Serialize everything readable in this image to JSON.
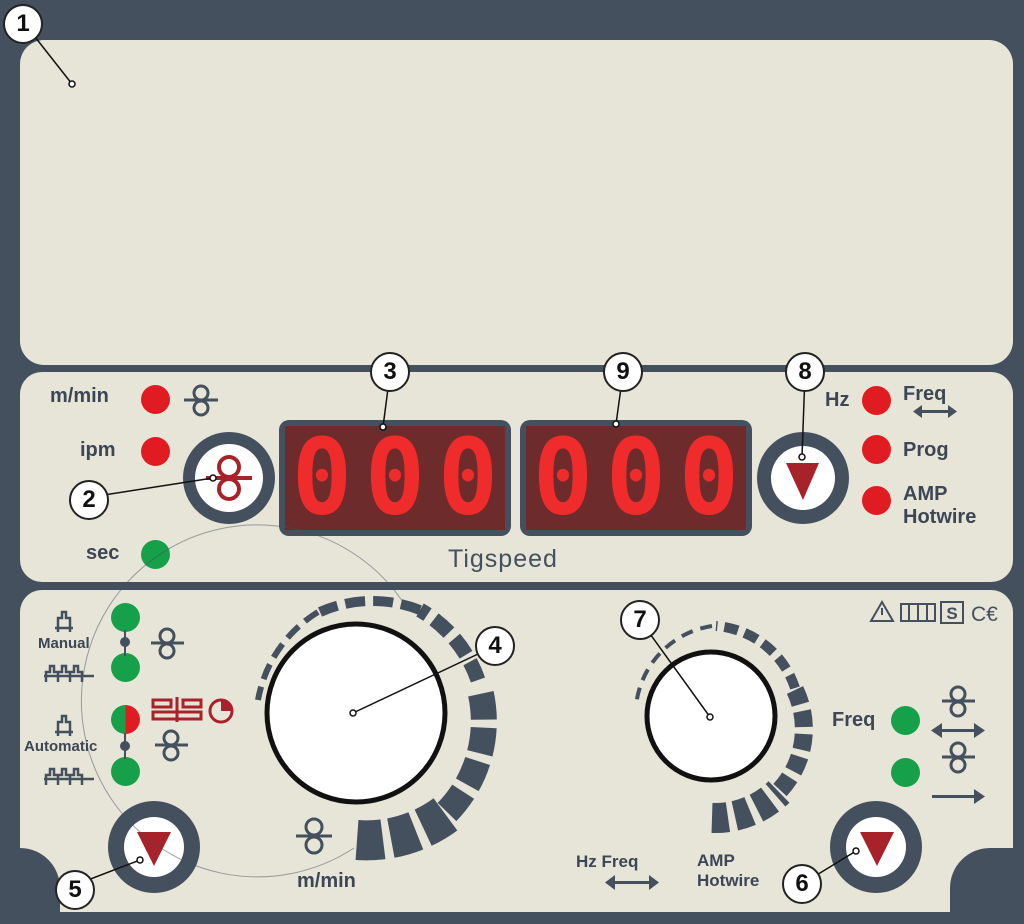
{
  "callouts": [
    "1",
    "2",
    "3",
    "9",
    "8",
    "4",
    "7",
    "5",
    "6"
  ],
  "display_left": {
    "digits": [
      "0",
      "0",
      "0"
    ]
  },
  "display_right": {
    "digits": [
      "0",
      "0",
      "0"
    ]
  },
  "display_caption": "Tigspeed",
  "left_indicators": {
    "m_min": "m/min",
    "ipm": "ipm",
    "sec": "sec"
  },
  "right_indicators": {
    "hz": "Hz",
    "freq": "Freq",
    "prog": "Prog",
    "amp": "AMP",
    "hotwire": "Hotwire"
  },
  "mode_labels": {
    "manual": "Manual",
    "automatic": "Automatic"
  },
  "dial_left_unit": "m/min",
  "bottom_labels": {
    "hz_freq": "Hz Freq",
    "amp": "AMP",
    "hotwire": "Hotwire",
    "freq": "Freq"
  },
  "colors": {
    "panel": "#e6e5d8",
    "frame": "#45505e",
    "led_red": "#e11b22",
    "led_green": "#16a04a",
    "segment": "#ef2b2b"
  },
  "icons": [
    "wire-feed-icon",
    "arrow-down-icon",
    "torch-2t-icon",
    "torch-4t-icon",
    "spot-icon",
    "timer-icon",
    "warning-icon",
    "book-icon",
    "s-mark-icon",
    "ce-icon"
  ]
}
